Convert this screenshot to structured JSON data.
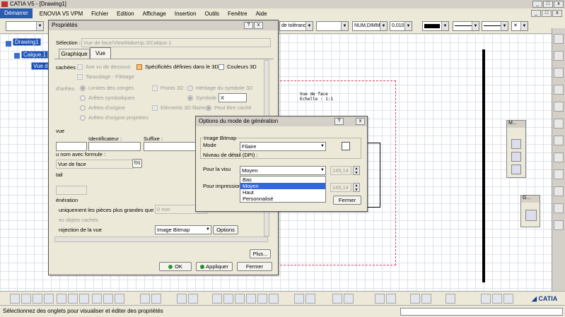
{
  "app": {
    "title": "CATIA V5 - [Drawing1]",
    "window_controls": [
      "_",
      "□",
      "x"
    ],
    "mdi_controls": [
      "_",
      "□",
      "x"
    ]
  },
  "menu": {
    "start": "Démarrer",
    "items": [
      "ENOVIA V5 VPM",
      "Fichier",
      "Edition",
      "Affichage",
      "Insertion",
      "Outils",
      "Fenêtre",
      "Aide"
    ]
  },
  "toolbar": {
    "combo_tolerance": "de tolérance",
    "combo_num": "NUM,DIMM",
    "combo_value": "0,010C"
  },
  "tree": {
    "items": [
      "Drawing1",
      "Calque.1",
      "Vue d"
    ]
  },
  "drawing": {
    "view_name": "Vue de face",
    "view_scale": "Echelle :  1:1"
  },
  "props_dialog": {
    "title": "Propriétés",
    "help": "?",
    "selection_label": "Sélection :",
    "selection_value": "Vue de face/ViewMakeUp.3/Calque.1",
    "tabs": [
      "Graphique",
      "Vue"
    ],
    "active_tab": "Vue",
    "rows": {
      "cachees": "cachées",
      "axe": "Axe vu de dessous",
      "specificites": "Spécificités définies dans le 3D",
      "couleurs": "Couleurs 3D",
      "taraudage": "Taraudage - Filetage",
      "aretes": "d'arêtes",
      "limites": "Limites des congés",
      "points3d": "Points 3D :",
      "heritage": "Héritage du symbole 3D",
      "aretes_symb": "Arêtes symboliques",
      "symbole": "Symbole",
      "symbole_value": "X",
      "aretes_origine": "Arêtes d'origine",
      "elements3d": "Eléments 3D filaires",
      "peut_etre": "Peut être caché",
      "aretes_orig_proj": "Arêtes d'origine projetées"
    },
    "vue_section": "vue",
    "identificateur": "Identificateur :",
    "suffixe": "Suffixe :",
    "nom_formule": "u nom avec formule :",
    "nom_value": "Vue de face",
    "fx": "f(x)",
    "detail": "tail",
    "generation": "énération",
    "uniquement": "uniquement les pièces plus grandes que",
    "mm_value": "0 mm",
    "objets_caches": "es objets cachés",
    "projection": "rojection de la vue",
    "projection_value": "Image Bitmap",
    "options_btn": "Options",
    "plus_btn": "Plus...",
    "ok_btn": "OK",
    "apply_btn": "Appliquer",
    "close_btn": "Fermer"
  },
  "options_dialog": {
    "title": "Options du mode de génération",
    "help": "?",
    "close": "x",
    "group_label": "Image Bitmap",
    "mode_label": "Mode",
    "mode_value": "Filaire",
    "detail_label": "Niveau de détail (DPI) :",
    "visu_label": "Pour la visu",
    "visu_value": "Moyen",
    "visu_dpi": "145,14",
    "impression_label": "Pour impression",
    "impression_dpi": "145,14",
    "dropdown_options": [
      "Bas",
      "Moyen",
      "Haut",
      "Personnalisé"
    ],
    "selected_option": "Moyen",
    "close_btn": "Fermer"
  },
  "panels": {
    "m_title": "M...",
    "g_title": "G..."
  },
  "status": {
    "text": "Sélectionnez des onglets pour visualiser et éditer des propriétés"
  },
  "colors": {
    "selection_blue": "#3168d5",
    "frame_red": "#d04060",
    "dialog_bg": "#ece9d8"
  }
}
